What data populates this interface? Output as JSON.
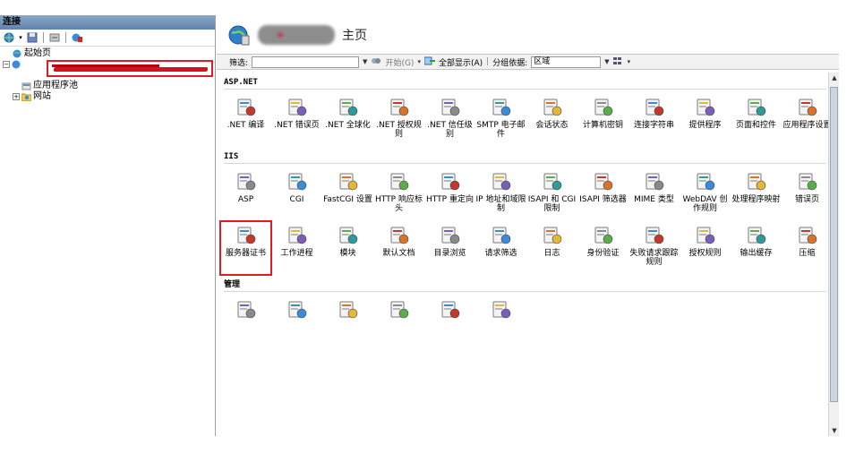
{
  "connections": {
    "title": "连接",
    "toolbar": [
      "globe-plus-icon",
      "save-icon",
      "connect-icon",
      "network-icon"
    ],
    "tree": [
      {
        "label": "起始页",
        "depth": 1
      },
      {
        "label": "应用程序池",
        "depth": 2
      },
      {
        "label": "网站",
        "depth": 2
      }
    ]
  },
  "header": {
    "title": "主页"
  },
  "filter": {
    "label": "筛选:",
    "placeholder": "",
    "start_label": "开始(G)",
    "show_all_label": "全部显示(A)",
    "group_by_label": "分组依据:",
    "group_by_value": "区域"
  },
  "sections": [
    {
      "title": "ASP.NET",
      "items": [
        {
          "label": ".NET 编译",
          "icon": "net-compile-icon"
        },
        {
          "label": ".NET 错误页",
          "icon": "net-error-pages-icon"
        },
        {
          "label": ".NET 全球化",
          "icon": "net-globalization-icon"
        },
        {
          "label": ".NET 授权规则",
          "icon": "net-authorization-icon"
        },
        {
          "label": ".NET 信任级别",
          "icon": "net-trust-levels-icon"
        },
        {
          "label": "SMTP 电子邮件",
          "icon": "smtp-email-icon"
        },
        {
          "label": "会话状态",
          "icon": "session-state-icon"
        },
        {
          "label": "计算机密钥",
          "icon": "machine-key-icon"
        },
        {
          "label": "连接字符串",
          "icon": "connection-strings-icon"
        },
        {
          "label": "提供程序",
          "icon": "providers-icon"
        },
        {
          "label": "页面和控件",
          "icon": "pages-controls-icon"
        },
        {
          "label": "应用程序设置",
          "icon": "app-settings-icon"
        }
      ]
    },
    {
      "title": "IIS",
      "items": [
        {
          "label": "ASP",
          "icon": "asp-icon"
        },
        {
          "label": "CGI",
          "icon": "cgi-icon"
        },
        {
          "label": "FastCGI 设置",
          "icon": "fastcgi-icon"
        },
        {
          "label": "HTTP 响应标头",
          "icon": "http-headers-icon"
        },
        {
          "label": "HTTP 重定向",
          "icon": "http-redirect-icon"
        },
        {
          "label": "IP 地址和域限制",
          "icon": "ip-restrictions-icon"
        },
        {
          "label": "ISAPI 和 CGI 限制",
          "icon": "isapi-cgi-icon"
        },
        {
          "label": "ISAPI 筛选器",
          "icon": "isapi-filters-icon"
        },
        {
          "label": "MIME 类型",
          "icon": "mime-types-icon"
        },
        {
          "label": "WebDAV 创作规则",
          "icon": "webdav-icon"
        },
        {
          "label": "处理程序映射",
          "icon": "handler-mappings-icon"
        },
        {
          "label": "错误页",
          "icon": "error-pages-icon"
        },
        {
          "label": "服务器证书",
          "icon": "server-certificates-icon"
        },
        {
          "label": "工作进程",
          "icon": "worker-processes-icon"
        },
        {
          "label": "模块",
          "icon": "modules-icon"
        },
        {
          "label": "默认文档",
          "icon": "default-document-icon"
        },
        {
          "label": "目录浏览",
          "icon": "directory-browsing-icon"
        },
        {
          "label": "请求筛选",
          "icon": "request-filtering-icon"
        },
        {
          "label": "日志",
          "icon": "logging-icon"
        },
        {
          "label": "身份验证",
          "icon": "authentication-icon"
        },
        {
          "label": "失败请求跟踪规则",
          "icon": "failed-request-icon"
        },
        {
          "label": "授权规则",
          "icon": "authorization-rules-icon"
        },
        {
          "label": "输出缓存",
          "icon": "output-caching-icon"
        },
        {
          "label": "压缩",
          "icon": "compression-icon"
        }
      ]
    },
    {
      "title": "管理",
      "items": [
        {
          "label": "",
          "icon": "iis-manager-permissions-icon"
        },
        {
          "label": "",
          "icon": "iis-manager-users-icon"
        },
        {
          "label": "",
          "icon": "delegation-icon"
        },
        {
          "label": "",
          "icon": "config-editor-icon"
        },
        {
          "label": "",
          "icon": "management-service-icon"
        },
        {
          "label": "",
          "icon": "shared-config-icon"
        }
      ]
    }
  ],
  "selected_item": "服务器证书",
  "colors": {
    "highlight": "#e01b24",
    "header": "#5f82ad"
  }
}
